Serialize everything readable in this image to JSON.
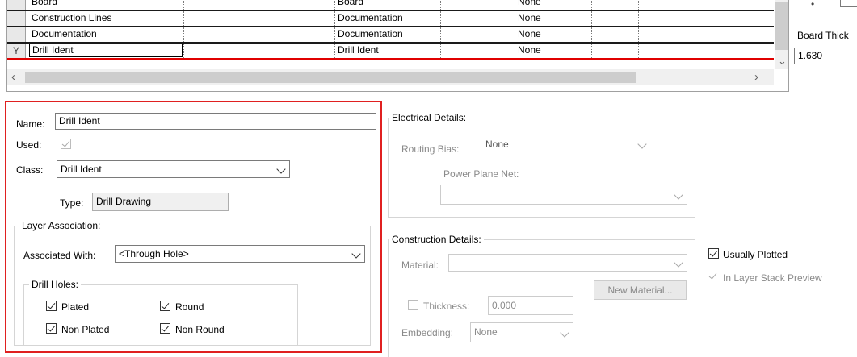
{
  "grid": {
    "rows": [
      {
        "name": "Board",
        "class": "Board",
        "plane": "None",
        "selected": false
      },
      {
        "name": "Construction Lines",
        "class": "Documentation",
        "plane": "None",
        "selected": false
      },
      {
        "name": "Documentation",
        "class": "Documentation",
        "plane": "None",
        "selected": false
      },
      {
        "name": "Drill Ident",
        "class": "Drill Ident",
        "plane": "None",
        "selected": true
      }
    ],
    "selected_marker": "Y"
  },
  "right_panel": {
    "board_thickness_label": "Board Thick",
    "board_thickness_value": "1.630"
  },
  "general": {
    "name_label": "Name:",
    "name_value": "Drill Ident",
    "used_label": "Used:",
    "class_label": "Class:",
    "class_value": "Drill Ident",
    "type_label": "Type:",
    "type_value": "Drill Drawing"
  },
  "layer_association": {
    "title": "Layer Association:",
    "associated_label": "Associated With:",
    "associated_value": "<Through Hole>",
    "drill_holes_title": "Drill Holes:",
    "plated": "Plated",
    "non_plated": "Non Plated",
    "round": "Round",
    "non_round": "Non Round"
  },
  "electrical": {
    "title": "Electrical Details:",
    "routing_bias_label": "Routing Bias:",
    "routing_bias_value": "None",
    "power_plane_label": "Power Plane Net:",
    "power_plane_value": ""
  },
  "construction": {
    "title": "Construction Details:",
    "material_label": "Material:",
    "material_value": "",
    "new_material_button": "New Material...",
    "thickness_label": "Thickness:",
    "thickness_value": "0.000",
    "embedding_label": "Embedding:",
    "embedding_value": "None"
  },
  "options": {
    "usually_plotted": "Usually Plotted",
    "in_layer_stack": "In Layer Stack Preview"
  },
  "colors": {
    "highlight_border": "#e02020",
    "selected_row_line": "#e00000"
  }
}
